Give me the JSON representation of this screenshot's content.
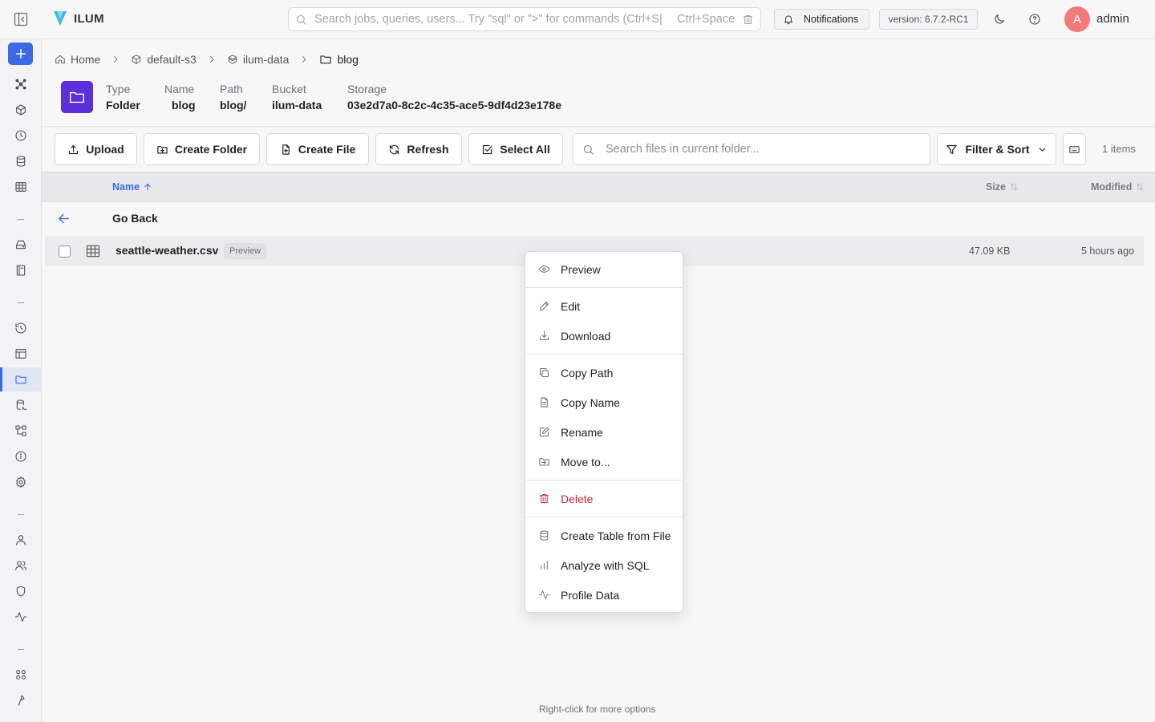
{
  "app": {
    "name": "ILUM",
    "brand_color": "#3b6ae6",
    "folder_badge_color": "#5b30d9"
  },
  "topbar": {
    "search_placeholder": "Search jobs, queries, users... Try \"sql\" or \">\" for commands (Ctrl+S|",
    "search_shortcut": "Ctrl+Space",
    "notifications_label": "Notifications",
    "version_label": "version: 6.7.2-RC1",
    "avatar_initial": "A",
    "username": "admin"
  },
  "breadcrumb": [
    {
      "label": "Home",
      "icon": "home-icon"
    },
    {
      "label": "default-s3",
      "icon": "package-icon"
    },
    {
      "label": "ilum-data",
      "icon": "bucket-icon"
    },
    {
      "label": "blog",
      "icon": "folder-icon"
    }
  ],
  "folder_info": {
    "type_label": "Type",
    "type_value": "Folder",
    "name_label": "Name",
    "name_value": "blog",
    "path_label": "Path",
    "path_value": "blog/",
    "bucket_label": "Bucket",
    "bucket_value": "ilum-data",
    "storage_label": "Storage",
    "storage_value": "03e2d7a0-8c2c-4c35-ace5-9df4d23e178e"
  },
  "toolbar": {
    "upload": "Upload",
    "create_folder": "Create Folder",
    "create_file": "Create File",
    "refresh": "Refresh",
    "select_all": "Select All",
    "search_placeholder": "Search files in current folder...",
    "filter_sort": "Filter & Sort",
    "items_count": "1 items"
  },
  "table": {
    "headers": {
      "name": "Name",
      "size": "Size",
      "modified": "Modified"
    },
    "go_back": "Go Back",
    "rows": [
      {
        "name": "seattle-weather.csv",
        "badge": "Preview",
        "size": "47.09 KB",
        "modified": "5 hours ago"
      }
    ]
  },
  "context_menu": {
    "items": [
      {
        "label": "Preview",
        "icon": "eye-icon"
      },
      {
        "label": "Edit",
        "icon": "pencil-icon"
      },
      {
        "label": "Download",
        "icon": "download-icon"
      },
      {
        "label": "Copy Path",
        "icon": "copy-icon"
      },
      {
        "label": "Copy Name",
        "icon": "file-text-icon"
      },
      {
        "label": "Rename",
        "icon": "edit-box-icon"
      },
      {
        "label": "Move to...",
        "icon": "move-icon"
      },
      {
        "label": "Delete",
        "icon": "trash-icon"
      },
      {
        "label": "Create Table from File",
        "icon": "database-icon"
      },
      {
        "label": "Analyze with SQL",
        "icon": "bar-chart-icon"
      },
      {
        "label": "Profile Data",
        "icon": "activity-icon"
      }
    ]
  },
  "footer": {
    "hint": "Right-click for more options"
  }
}
